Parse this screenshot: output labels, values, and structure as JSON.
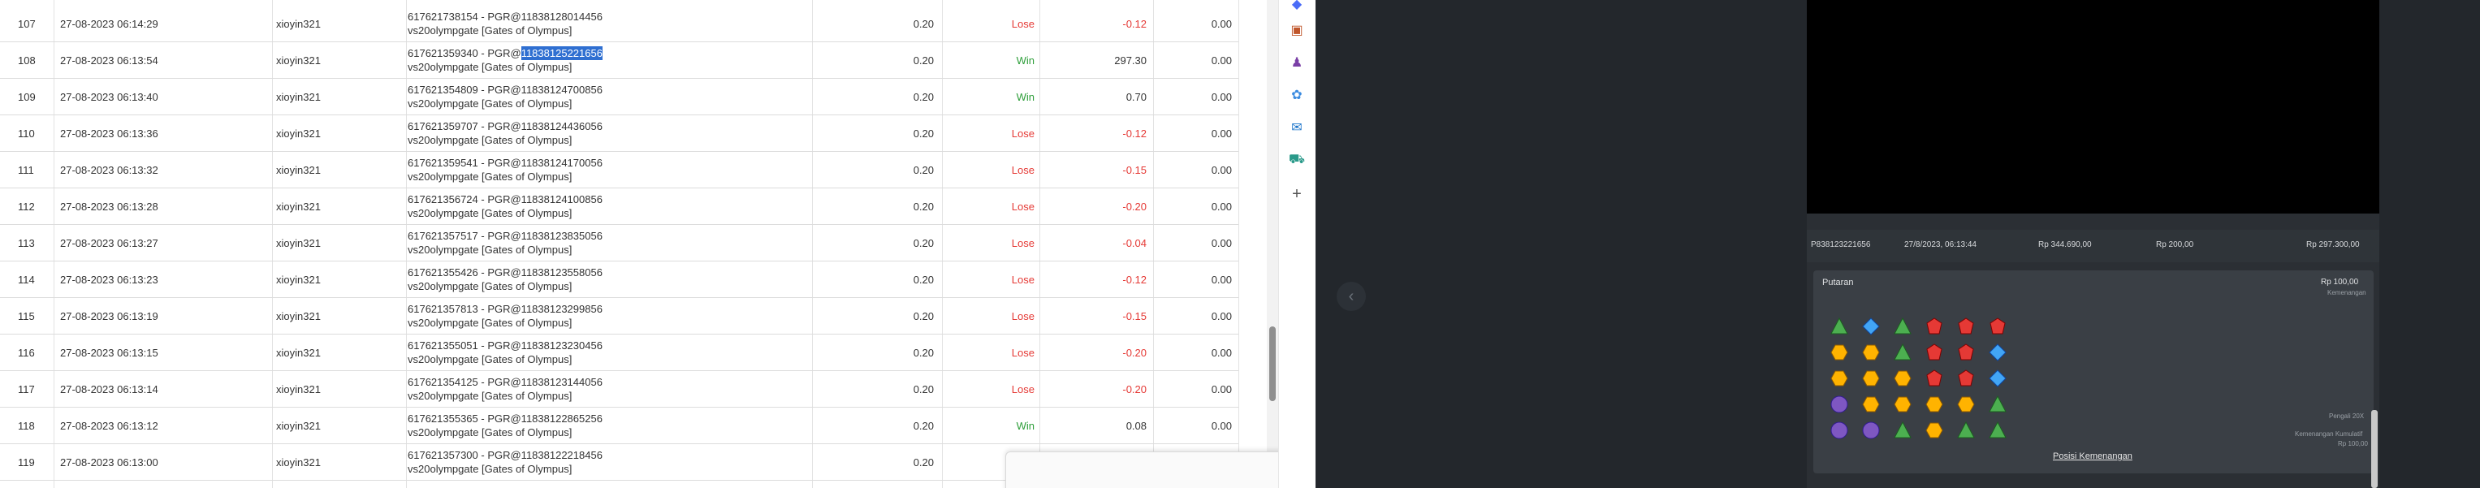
{
  "table": {
    "rows": [
      {
        "no": "107",
        "date": "27-08-2023 06:14:29",
        "user": "xioyin321",
        "desc1": "617621738154 - PGR@11838128014456",
        "desc1_pre": "",
        "desc1_hl": "",
        "desc2": "vs20olympgate [Gates of Olympus]",
        "bet": "0.20",
        "result": "Lose",
        "amount": "-0.12",
        "balance": "0.00"
      },
      {
        "no": "108",
        "date": "27-08-2023 06:13:54",
        "user": "xioyin321",
        "desc1": "",
        "desc1_pre": "617621359340 - PGR@",
        "desc1_hl": "11838125221656",
        "desc2": "vs20olympgate [Gates of Olympus]",
        "bet": "0.20",
        "result": "Win",
        "amount": "297.30",
        "balance": "0.00"
      },
      {
        "no": "109",
        "date": "27-08-2023 06:13:40",
        "user": "xioyin321",
        "desc1": "617621354809 - PGR@11838124700856",
        "desc1_pre": "",
        "desc1_hl": "",
        "desc2": "vs20olympgate [Gates of Olympus]",
        "bet": "0.20",
        "result": "Win",
        "amount": "0.70",
        "balance": "0.00"
      },
      {
        "no": "110",
        "date": "27-08-2023 06:13:36",
        "user": "xioyin321",
        "desc1": "617621359707 - PGR@11838124436056",
        "desc1_pre": "",
        "desc1_hl": "",
        "desc2": "vs20olympgate [Gates of Olympus]",
        "bet": "0.20",
        "result": "Lose",
        "amount": "-0.12",
        "balance": "0.00"
      },
      {
        "no": "111",
        "date": "27-08-2023 06:13:32",
        "user": "xioyin321",
        "desc1": "617621359541 - PGR@11838124170056",
        "desc1_pre": "",
        "desc1_hl": "",
        "desc2": "vs20olympgate [Gates of Olympus]",
        "bet": "0.20",
        "result": "Lose",
        "amount": "-0.15",
        "balance": "0.00"
      },
      {
        "no": "112",
        "date": "27-08-2023 06:13:28",
        "user": "xioyin321",
        "desc1": "617621356724 - PGR@11838124100856",
        "desc1_pre": "",
        "desc1_hl": "",
        "desc2": "vs20olympgate [Gates of Olympus]",
        "bet": "0.20",
        "result": "Lose",
        "amount": "-0.20",
        "balance": "0.00"
      },
      {
        "no": "113",
        "date": "27-08-2023 06:13:27",
        "user": "xioyin321",
        "desc1": "617621357517 - PGR@11838123835056",
        "desc1_pre": "",
        "desc1_hl": "",
        "desc2": "vs20olympgate [Gates of Olympus]",
        "bet": "0.20",
        "result": "Lose",
        "amount": "-0.04",
        "balance": "0.00"
      },
      {
        "no": "114",
        "date": "27-08-2023 06:13:23",
        "user": "xioyin321",
        "desc1": "617621355426 - PGR@11838123558056",
        "desc1_pre": "",
        "desc1_hl": "",
        "desc2": "vs20olympgate [Gates of Olympus]",
        "bet": "0.20",
        "result": "Lose",
        "amount": "-0.12",
        "balance": "0.00"
      },
      {
        "no": "115",
        "date": "27-08-2023 06:13:19",
        "user": "xioyin321",
        "desc1": "617621357813 - PGR@11838123299856",
        "desc1_pre": "",
        "desc1_hl": "",
        "desc2": "vs20olympgate [Gates of Olympus]",
        "bet": "0.20",
        "result": "Lose",
        "amount": "-0.15",
        "balance": "0.00"
      },
      {
        "no": "116",
        "date": "27-08-2023 06:13:15",
        "user": "xioyin321",
        "desc1": "617621355051 - PGR@11838123230456",
        "desc1_pre": "",
        "desc1_hl": "",
        "desc2": "vs20olympgate [Gates of Olympus]",
        "bet": "0.20",
        "result": "Lose",
        "amount": "-0.20",
        "balance": "0.00"
      },
      {
        "no": "117",
        "date": "27-08-2023 06:13:14",
        "user": "xioyin321",
        "desc1": "617621354125 - PGR@11838123144056",
        "desc1_pre": "",
        "desc1_hl": "",
        "desc2": "vs20olympgate [Gates of Olympus]",
        "bet": "0.20",
        "result": "Lose",
        "amount": "-0.20",
        "balance": "0.00"
      },
      {
        "no": "118",
        "date": "27-08-2023 06:13:12",
        "user": "xioyin321",
        "desc1": "617621355365 - PGR@11838122865256",
        "desc1_pre": "",
        "desc1_hl": "",
        "desc2": "vs20olympgate [Gates of Olympus]",
        "bet": "0.20",
        "result": "Win",
        "amount": "0.08",
        "balance": "0.00"
      },
      {
        "no": "119",
        "date": "27-08-2023 06:13:00",
        "user": "xioyin321",
        "desc1": "617621357300 - PGR@11838122218456",
        "desc1_pre": "",
        "desc1_hl": "",
        "desc2": "vs20olympgate [Gates of Olympus]",
        "bet": "0.20",
        "result": "",
        "amount": "",
        "balance": ""
      }
    ]
  },
  "sidebar_icons": [
    "toolbox-icon",
    "people-icon",
    "copilot-icon",
    "outlook-icon",
    "shopping-icon",
    "add-icon"
  ],
  "game": {
    "history_row": {
      "id": "P838123221656",
      "date": "27/8/2023, 06:13:44",
      "balance": "Rp 344.690,00",
      "bet": "Rp 200,00",
      "win": "Rp 297.300,00"
    },
    "putaran_label": "Putaran",
    "putaran_value": "Rp 100,00",
    "putaran_sub": "Kemenangan",
    "pengali_label": "Pengali 20X",
    "kumulatif_label": "Kemenangan Kumulatif",
    "kumulatif_value": "Rp 100,00",
    "posisi_link": "Posisi Kemenangan"
  },
  "colors": {
    "win": "#2e9e3a",
    "lose": "#e53935",
    "highlight": "#2f6fd1",
    "dark_bg": "#23272c"
  }
}
